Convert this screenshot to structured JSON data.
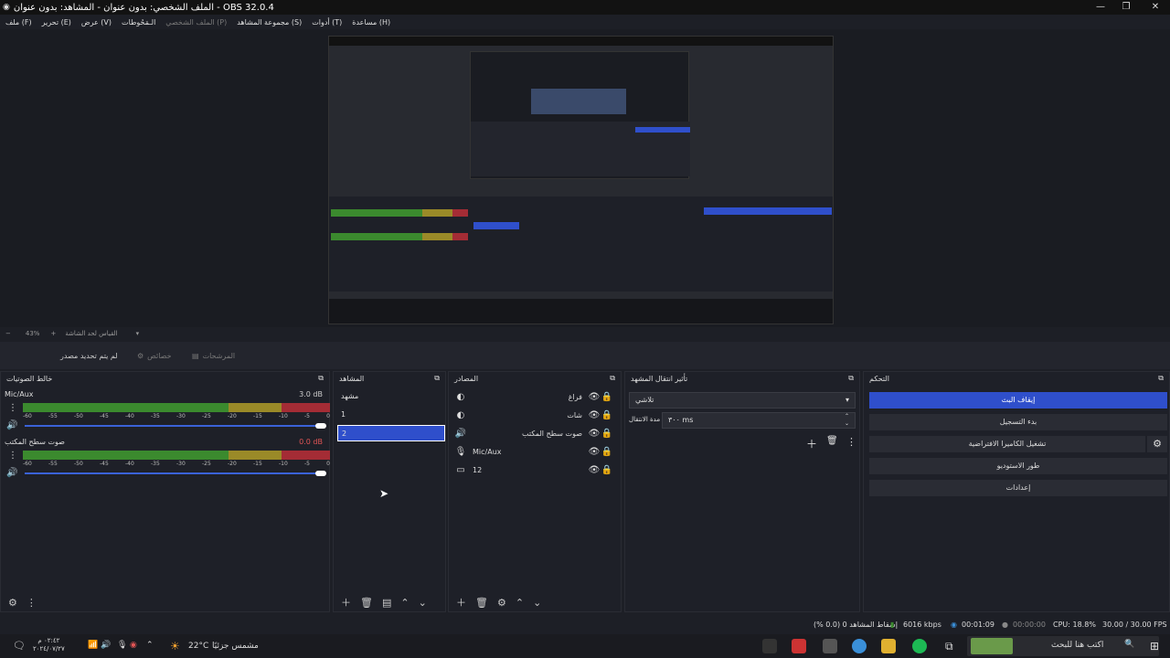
{
  "window": {
    "title": "OBS 32.0.4 - الملف الشخصي: بدون عنوان - المشاهد: بدون عنوان",
    "controls": [
      "—",
      "❐",
      "✕"
    ]
  },
  "menu": [
    {
      "label": "ملف (F)",
      "dim": false
    },
    {
      "label": "تحرير (E)",
      "dim": false
    },
    {
      "label": "عرض (V)",
      "dim": false
    },
    {
      "label": "الـمَحُوطات",
      "dim": false
    },
    {
      "label": "الملف الشخصي (P)",
      "dim": true
    },
    {
      "label": "مجموعة المشاهد (S)",
      "dim": false
    },
    {
      "label": "أدوات (T)",
      "dim": false
    },
    {
      "label": "مساعدة (H)",
      "dim": false
    }
  ],
  "zoombar": {
    "zoom": "43%",
    "label": "القياس لحد الشاشة"
  },
  "source_toolbar": {
    "no_source": "لم يتم تحديد مصدر",
    "properties": "خصائص",
    "filters": "المرشحات"
  },
  "mixer": {
    "title": "خالط الصوتيات",
    "channels": [
      {
        "name": "Mic/Aux",
        "db": "3.0 dB",
        "db_color": "#ccc",
        "level": 1.0
      },
      {
        "name": "صوت سطح المكتب",
        "db": "0.0 dB",
        "db_color": "#e15555",
        "level": 1.0
      }
    ],
    "ticks": [
      "-60",
      "-55",
      "-50",
      "-45",
      "-40",
      "-35",
      "-30",
      "-25",
      "-20",
      "-15",
      "-10",
      "-5",
      "0"
    ]
  },
  "scenes": {
    "title": "المشاهد",
    "items": [
      {
        "label": "مشهد",
        "selected": false
      },
      {
        "label": "1",
        "selected": false
      },
      {
        "label": "2",
        "selected": true
      }
    ]
  },
  "sources": {
    "title": "المصادر",
    "items": [
      {
        "label": "فراغ",
        "icon": "browser-icon"
      },
      {
        "label": "شات",
        "icon": "browser-icon"
      },
      {
        "label": "صوت سطح المكتب",
        "icon": "speaker-icon"
      },
      {
        "label": "Mic/Aux",
        "icon": "mic-icon"
      },
      {
        "label": "12",
        "icon": "display-icon"
      }
    ]
  },
  "transitions": {
    "title": "تأثير انتقال المشهد",
    "type": "تلاشي",
    "duration_label": "مدة الانتقال",
    "duration_value": "٣٠٠ ms"
  },
  "controls": {
    "title": "التحكم",
    "buttons": [
      {
        "label": "إيقاف البث",
        "primary": true
      },
      {
        "label": "بدء التسجيل",
        "primary": false
      },
      {
        "label": "تشغيل الكاميرا الافتراضية",
        "primary": false
      },
      {
        "label": "طور الاستوديو",
        "primary": false
      },
      {
        "label": "إعدادات",
        "primary": false
      }
    ]
  },
  "status": {
    "dropped": "إسقاط المشاهد 0 (0.0 %)",
    "bitrate": "6016 kbps",
    "stream_time": "00:01:09",
    "rec_time": "00:00:00",
    "cpu": "CPU: 18.8%",
    "fps": "30.00 / 30.00 FPS"
  },
  "taskbar": {
    "search_placeholder": "اكتب هنا للبحث",
    "weather_temp": "22°C",
    "weather_desc": "مشمس جزئيًا",
    "clock_time": "٠٢:٤٢ م",
    "clock_date": "٢٠٢٤/٠٧/٢٧"
  },
  "colors": {
    "accent": "#2f4fcb",
    "meter_green": "#3b8a2e",
    "meter_yellow": "#9a8a28",
    "meter_red": "#a42c35"
  }
}
